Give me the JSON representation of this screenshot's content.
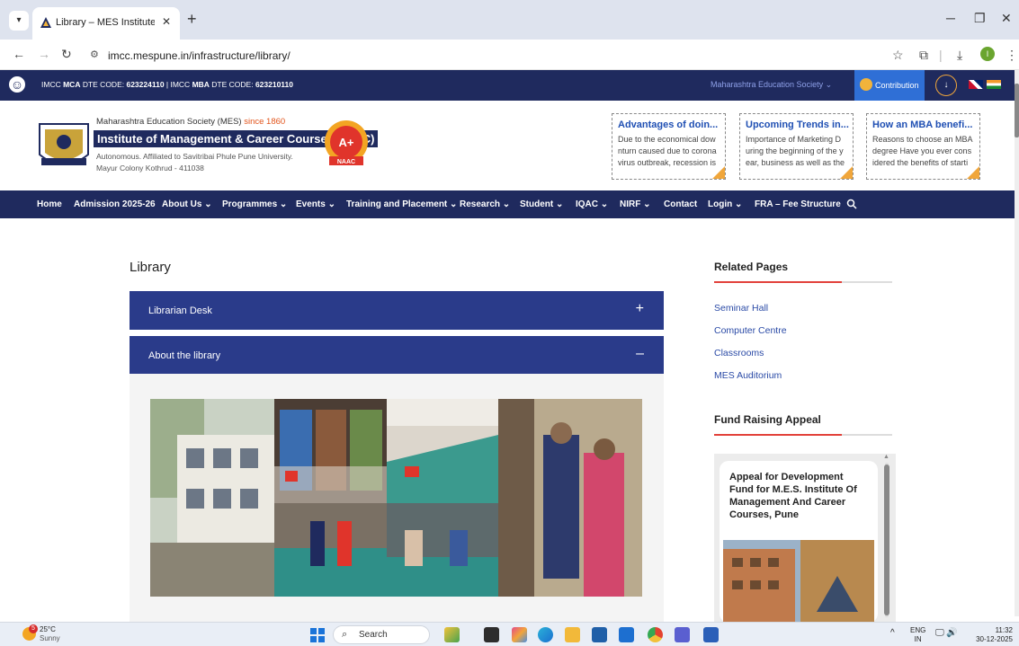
{
  "browser": {
    "tab_title": "Library – MES Institute of Mana",
    "url": "imcc.mespune.in/infrastructure/library/",
    "tab_menu_icon": "chevron-down-icon",
    "close_glyph": "✕",
    "new_tab_glyph": "+",
    "minimize_glyph": "─",
    "restore_glyph": "❐",
    "window_close_glyph": "✕",
    "profile_initial": "I"
  },
  "topstrip": {
    "dte_prefix": "IMCC ",
    "mca_label": "MCA",
    "mca_code_text": " DTE CODE: ",
    "mca_code": "623224110",
    "sep": " | IMCC ",
    "mba_label": "MBA",
    "mba_code_text": " DTE CODE: ",
    "mba_code": "623210110",
    "society_link": "Maharashtra Education Society ⌄",
    "contribution": "Contribution",
    "colors": {
      "strip": "#1f2a5e",
      "contribution": "#2f6fd6"
    }
  },
  "header": {
    "society": "Maharashtra Education Society (MES) ",
    "since": "since 1860",
    "institute": "Institute of Management & Career Courses (IMCC)",
    "affiliation": "Autonomous. Affiliated to Savitribai Phule Pune University.",
    "address": "Mayur Colony Kothrud - 411038",
    "naac_grade": "A+",
    "naac_label": "NAAC",
    "news": [
      {
        "title": "Advantages of doin...",
        "body": "Due to the economical dow nturn caused due to corona virus outbreak, recession is"
      },
      {
        "title": "Upcoming Trends in...",
        "body": "Importance of Marketing D uring the beginning of the y ear, business as well as the"
      },
      {
        "title": "How an MBA benefi...",
        "body": "Reasons to choose an MBA degree Have you ever cons idered the benefits of starti"
      }
    ]
  },
  "nav": {
    "items": [
      "Home",
      "Admission 2025-26",
      "About Us ⌄",
      "Programmes ⌄",
      "Events ⌄",
      "Training and Placement ⌄",
      "Research ⌄",
      "Student ⌄",
      "IQAC ⌄",
      "NIRF ⌄",
      "Contact",
      "Login ⌄",
      "FRA – Fee Structure"
    ],
    "search_icon": "search-icon"
  },
  "main": {
    "title": "Library",
    "accordions": [
      {
        "label": "Librarian Desk",
        "state": "+"
      },
      {
        "label": "About the library",
        "state": "–"
      }
    ]
  },
  "sidebar": {
    "related_heading": "Related Pages",
    "related_links": [
      "Seminar Hall",
      "Computer Centre",
      "Classrooms",
      "MES Auditorium"
    ],
    "fund_heading": "Fund Raising Appeal",
    "appeal_title": "Appeal for Development Fund for M.E.S. Institute Of Management And Career Courses, Pune",
    "accent": "#e2413a"
  },
  "taskbar": {
    "temp": "25°C",
    "condition": "Sunny",
    "weather_badge": "5",
    "search_label": "Search",
    "lang_top": "ENG",
    "lang_bottom": "IN",
    "time": "11:32",
    "date": "30-12-2025",
    "tray_up_glyph": "^",
    "tray_glyph": "🖵 🔊"
  }
}
